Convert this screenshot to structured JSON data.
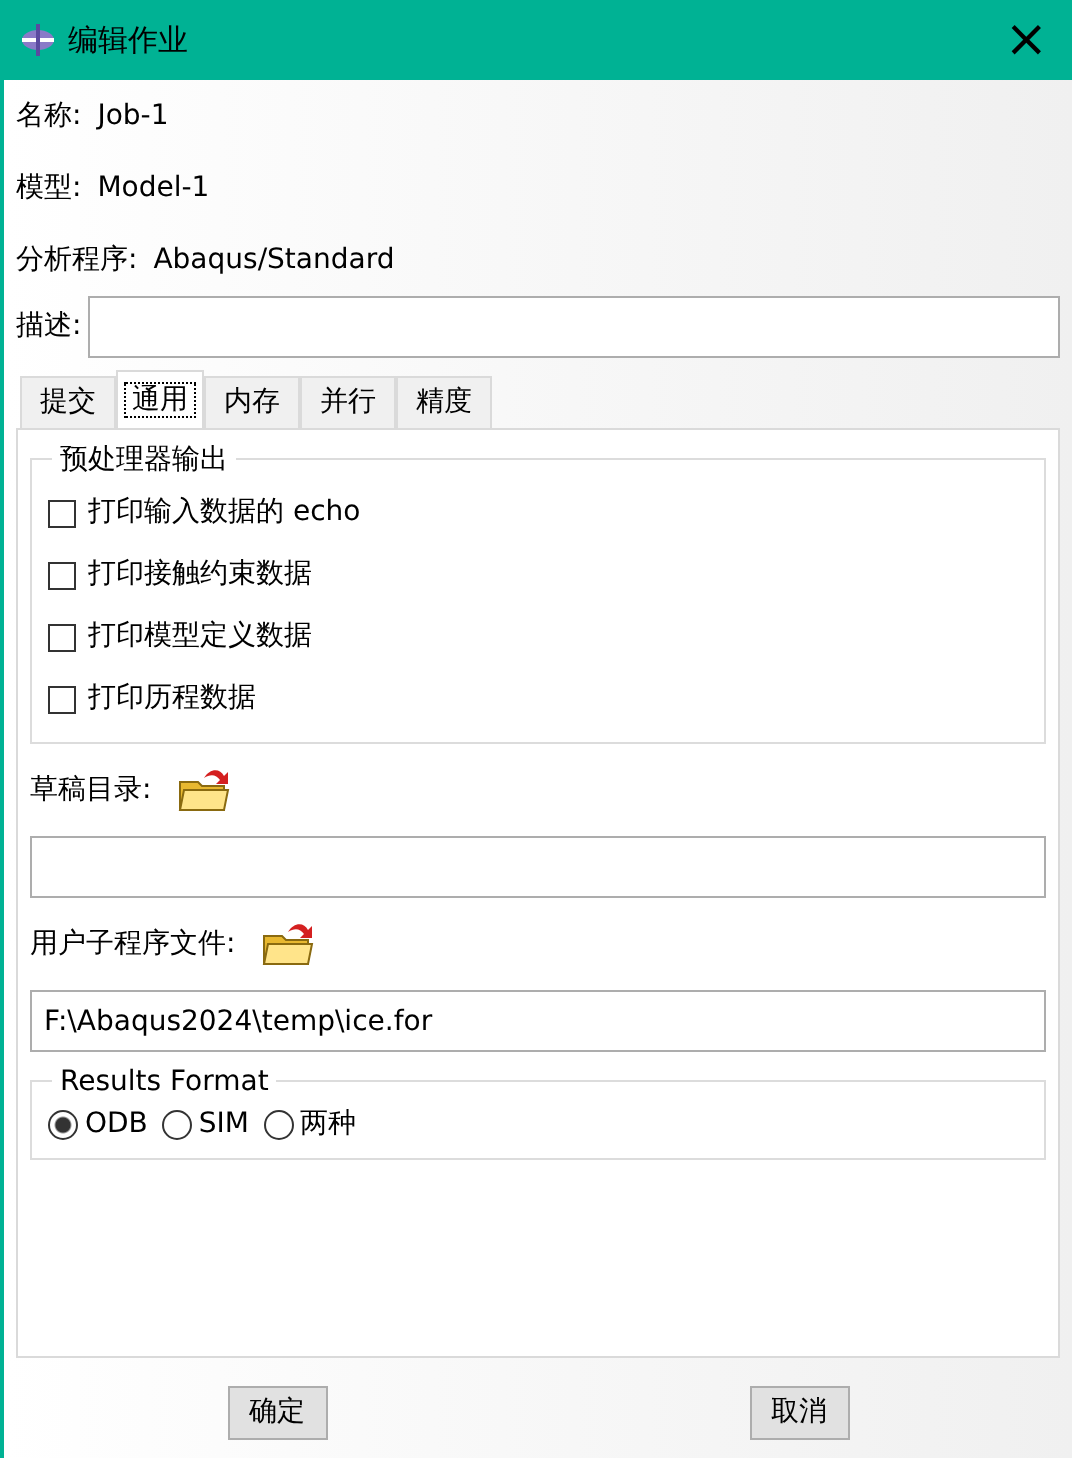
{
  "window": {
    "title": "编辑作业",
    "close": "×"
  },
  "info": [
    {
      "label": "名称:",
      "value": "Job-1"
    },
    {
      "label": "模型:",
      "value": "Model-1"
    },
    {
      "label": "分析程序:",
      "value": "Abaqus/Standard"
    }
  ],
  "description": {
    "label": "描述:"
  },
  "tabs": [
    {
      "label": "提交",
      "selected": false
    },
    {
      "label": "通用",
      "selected": true
    },
    {
      "label": "内存",
      "selected": false
    },
    {
      "label": "并行",
      "selected": false
    },
    {
      "label": "精度",
      "selected": false
    }
  ],
  "preprocessor": {
    "title": "预处理器输出",
    "options": [
      {
        "label": "打印输入数据的 echo",
        "checked": false
      },
      {
        "label": "打印接触约束数据",
        "checked": false
      },
      {
        "label": "打印模型定义数据",
        "checked": false
      },
      {
        "label": "打印历程数据",
        "checked": false
      }
    ]
  },
  "scratch_dir": {
    "label": "草稿目录:"
  },
  "user_subroutine": {
    "label": "用户子程序文件:",
    "value": "F:\\Abaqus2024\\temp\\ice.for"
  },
  "results_format": {
    "title": "Results Format",
    "options": [
      {
        "label": "ODB",
        "selected": true
      },
      {
        "label": "SIM",
        "selected": false
      },
      {
        "label": "两种",
        "selected": false
      }
    ]
  },
  "buttons": [
    "确定",
    "取消"
  ]
}
